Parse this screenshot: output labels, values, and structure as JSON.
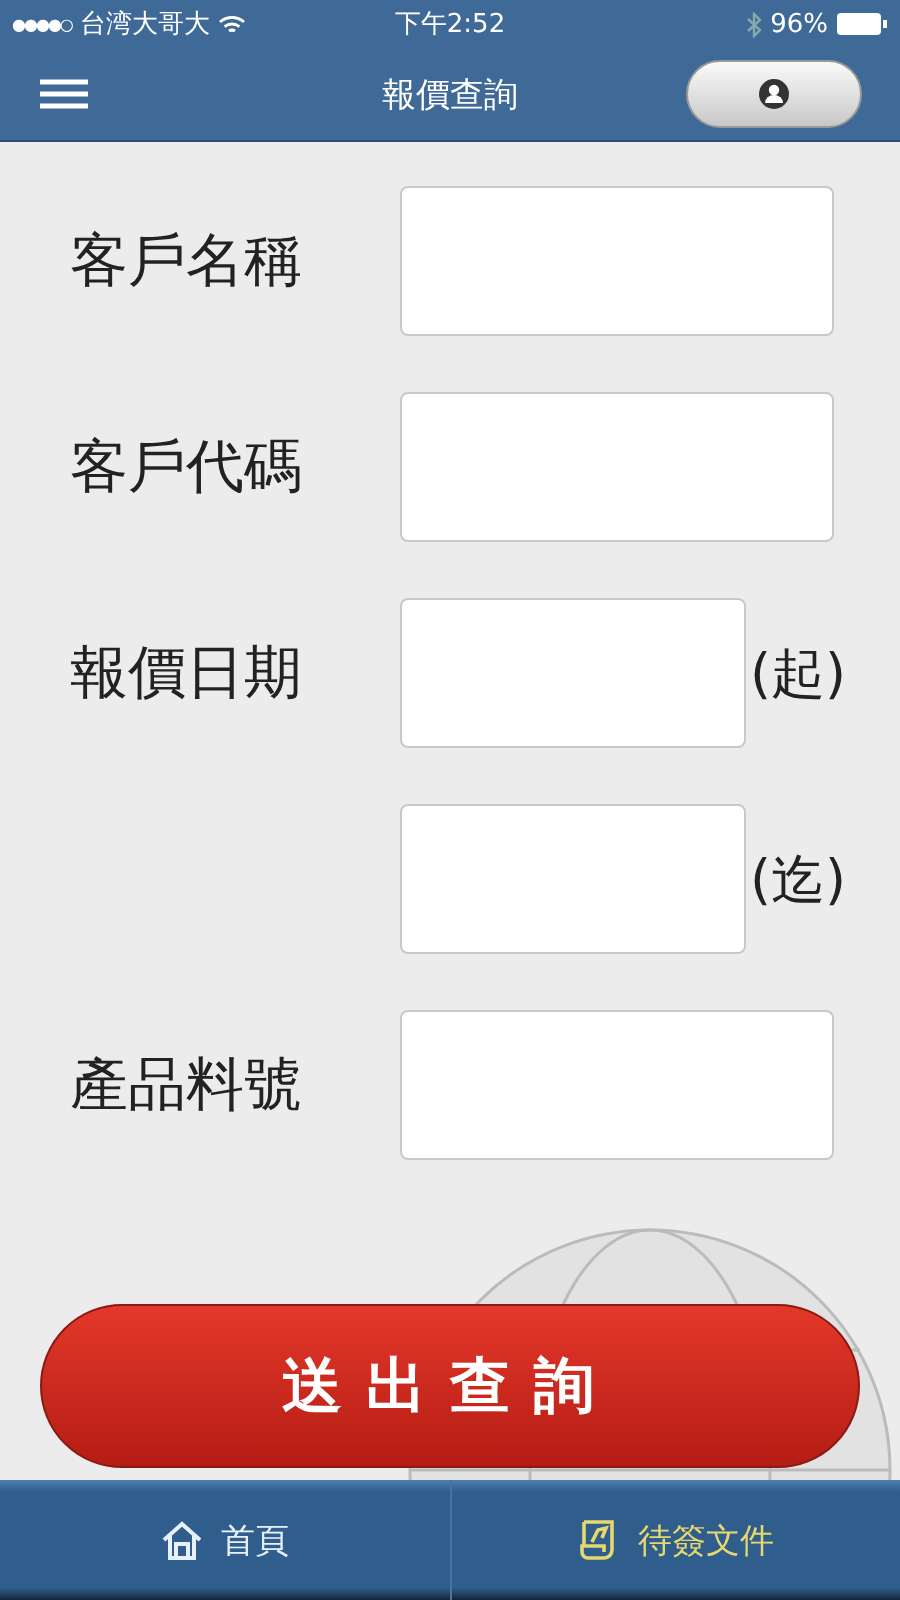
{
  "status_bar": {
    "signal": "●●●●○",
    "carrier": "台湾大哥大",
    "time": "下午2:52",
    "battery": "96%"
  },
  "nav": {
    "title": "報價查詢"
  },
  "form": [
    {
      "kind": "text",
      "label": "客戶名稱"
    },
    {
      "kind": "text",
      "label": "客戶代碼"
    },
    {
      "kind": "date",
      "label": "報價日期",
      "suffix": "(起)"
    },
    {
      "kind": "date",
      "suffix": "(迄)"
    },
    {
      "kind": "text",
      "label": "產品料號"
    }
  ],
  "submit": "送出查詢",
  "tabs": [
    {
      "label": "首頁",
      "kind": "home",
      "selected": false
    },
    {
      "label": "待簽文件",
      "kind": "docs",
      "selected": true
    }
  ]
}
